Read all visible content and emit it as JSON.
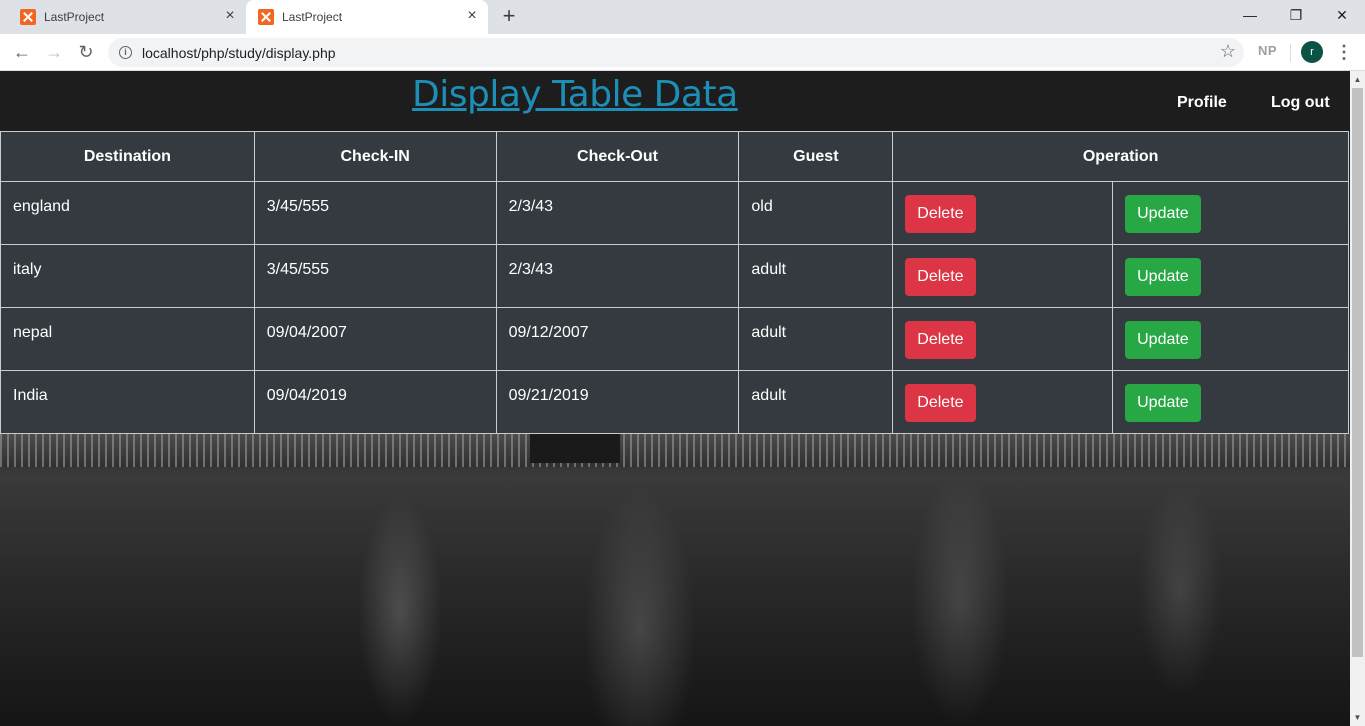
{
  "browser": {
    "tabs": [
      {
        "title": "LastProject",
        "active": false
      },
      {
        "title": "LastProject",
        "active": true
      }
    ],
    "new_tab_symbol": "+",
    "url": "localhost/php/study/display.php",
    "extension_label": "NP",
    "profile_initial": "r"
  },
  "page": {
    "title": "Display Table Data",
    "nav": {
      "profile": "Profile",
      "logout": "Log out"
    }
  },
  "table": {
    "headers": [
      "Destination",
      "Check-IN",
      "Check-Out",
      "Guest",
      "Operation"
    ],
    "rows": [
      {
        "destination": "england",
        "checkin": "3/45/555",
        "checkout": "2/3/43",
        "guest": "old"
      },
      {
        "destination": "italy",
        "checkin": "3/45/555",
        "checkout": "2/3/43",
        "guest": "adult"
      },
      {
        "destination": "nepal",
        "checkin": "09/04/2007",
        "checkout": "09/12/2007",
        "guest": "adult"
      },
      {
        "destination": "India",
        "checkin": "09/04/2019",
        "checkout": "09/21/2019",
        "guest": "adult"
      }
    ],
    "delete_label": "Delete",
    "update_label": "Update"
  },
  "colors": {
    "title_link": "#1d8fb6",
    "table_bg": "#343a40",
    "delete_button": "#dc3545",
    "update_button": "#28a745"
  }
}
